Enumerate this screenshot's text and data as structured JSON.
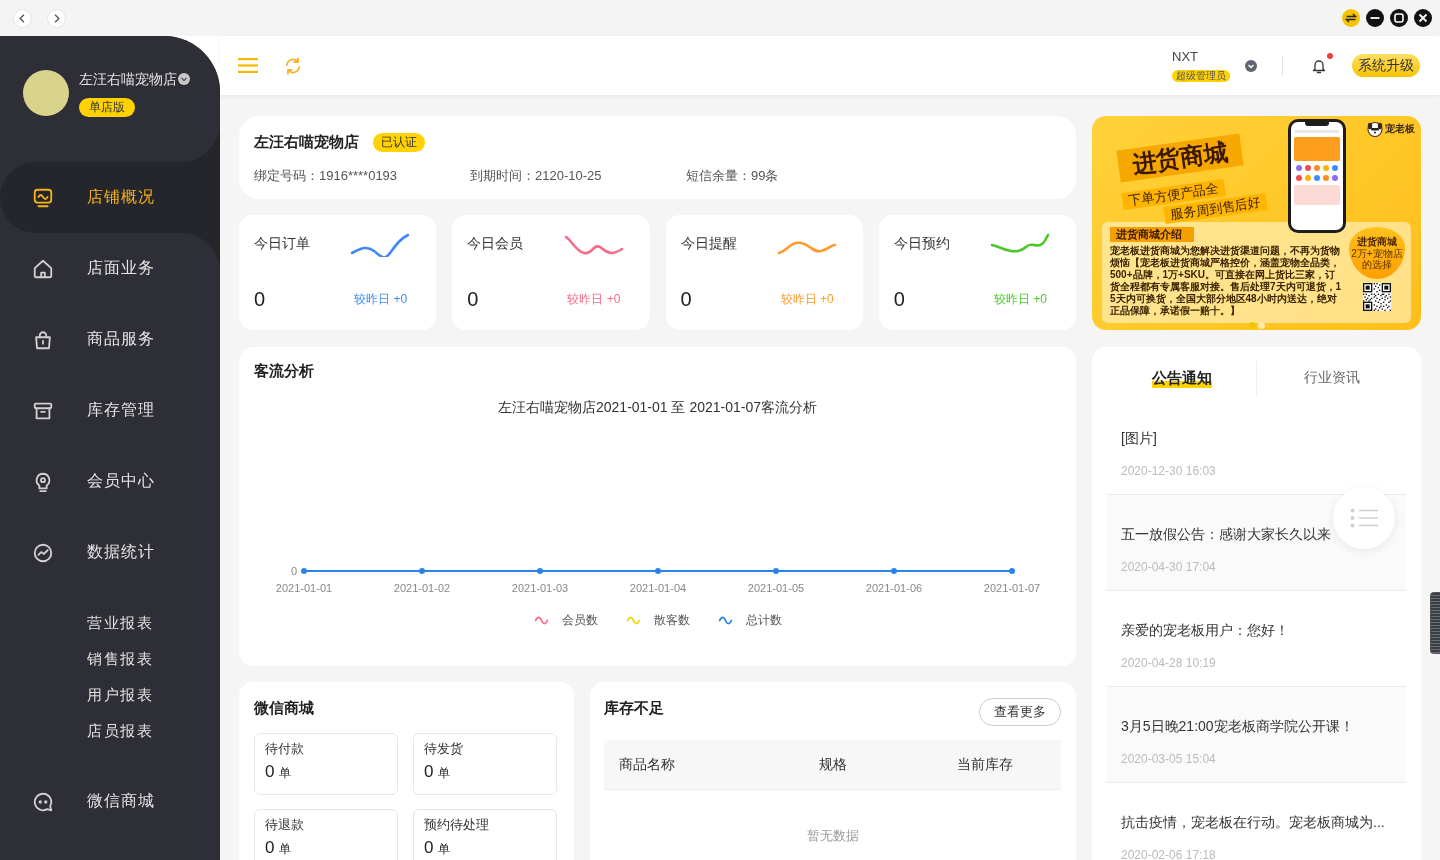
{
  "sidebar": {
    "store_name": "左汪右喵宠物店",
    "edition_badge": "单店版",
    "items": [
      {
        "label": "店铺概况",
        "selected": true
      },
      {
        "label": "店面业务",
        "selected": false
      },
      {
        "label": "商品服务",
        "selected": false
      },
      {
        "label": "库存管理",
        "selected": false
      },
      {
        "label": "会员中心",
        "selected": false
      },
      {
        "label": "数据统计",
        "selected": false,
        "children": [
          {
            "label": "营业报表",
            "selected": false
          },
          {
            "label": "销售报表",
            "selected": false
          },
          {
            "label": "用户报表",
            "selected": false
          },
          {
            "label": "店员报表",
            "selected": false
          }
        ]
      },
      {
        "label": "微信商城",
        "selected": false
      }
    ]
  },
  "header": {
    "user_name": "NXT",
    "role_badge": "超级管理员",
    "unread": true,
    "upgrade_button": "系统升级"
  },
  "store": {
    "name": "左汪右喵宠物店",
    "verified_badge": "已认证",
    "info": [
      "绑定号码：1916****0193",
      "到期时间：2120-10-25",
      "短信余量：99条"
    ]
  },
  "stats": [
    {
      "title": "今日订单",
      "value": "0",
      "compare": "较昨日 +0",
      "color": "#3d8af7"
    },
    {
      "title": "今日会员",
      "value": "0",
      "compare": "较昨日 +0",
      "color": "#f56c8a"
    },
    {
      "title": "今日提醒",
      "value": "0",
      "compare": "较昨日 +0",
      "color": "#ff9a2e"
    },
    {
      "title": "今日预约",
      "value": "0",
      "compare": "较昨日 +0",
      "color": "#4cc72a"
    }
  ],
  "traffic": {
    "title": "客流分析",
    "chart_title": "左汪右喵宠物店2021-01-01 至 2021-01-07客流分析",
    "y_tick": "0",
    "x_labels": [
      "2021-01-01",
      "2021-01-02",
      "2021-01-03",
      "2021-01-04",
      "2021-01-05",
      "2021-01-06",
      "2021-01-07"
    ],
    "legend": [
      {
        "label": "会员数",
        "color": "#f56c8a"
      },
      {
        "label": "散客数",
        "color": "#f5d600"
      },
      {
        "label": "总计数",
        "color": "#2a84e8"
      }
    ]
  },
  "wechat_mall": {
    "title": "微信商城",
    "tiles": [
      {
        "label": "待付款",
        "count": "0",
        "unit": "单"
      },
      {
        "label": "待发货",
        "count": "0",
        "unit": "单"
      },
      {
        "label": "待退款",
        "count": "0",
        "unit": "单"
      },
      {
        "label": "预约待处理",
        "count": "0",
        "unit": "单"
      }
    ]
  },
  "low_stock": {
    "title": "库存不足",
    "more_button": "查看更多",
    "columns": [
      "商品名称",
      "规格",
      "当前库存"
    ],
    "empty_text": "暂无数据"
  },
  "banner": {
    "headline": "进货商城",
    "slogans": [
      "下单方便产品全",
      "服务周到售后好"
    ],
    "brand": "宠老板",
    "intro_title": "进货商城介绍",
    "intro_text": "宠老板进货商城为您解决进货渠道问题，不再为货物烦恼【宠老板进货商城严格控价，涵盖宠物全品类，500+品牌，1万+SKU。可直接在网上货比三家，订货全程都有专属客服对接。售后处理7天内可退货，15天内可换货，全国大部分地区48小时内送达，绝对正品保障，承诺假一赔十。】",
    "badge_title": "进货商城",
    "badge_text": "2万+宠物店的选择",
    "slides": [
      {
        "selected": true
      },
      {
        "selected": false
      }
    ]
  },
  "notices": {
    "tabs": [
      {
        "label": "公告通知",
        "selected": true
      },
      {
        "label": "行业资讯",
        "selected": false
      }
    ],
    "items": [
      {
        "title": "[图片]",
        "date": "2020-12-30 16:03"
      },
      {
        "title": "五一放假公告：感谢大家长久以来",
        "date": "2020-04-30 17:04"
      },
      {
        "title": "亲爱的宠老板用户：您好！",
        "date": "2020-04-28 10:19"
      },
      {
        "title": "3月5日晚21:00宠老板商学院公开课！",
        "date": "2020-03-05 15:04"
      },
      {
        "title": "抗击疫情，宠老板在行动。宠老板商城为...",
        "date": "2020-02-06 17:18"
      }
    ]
  }
}
